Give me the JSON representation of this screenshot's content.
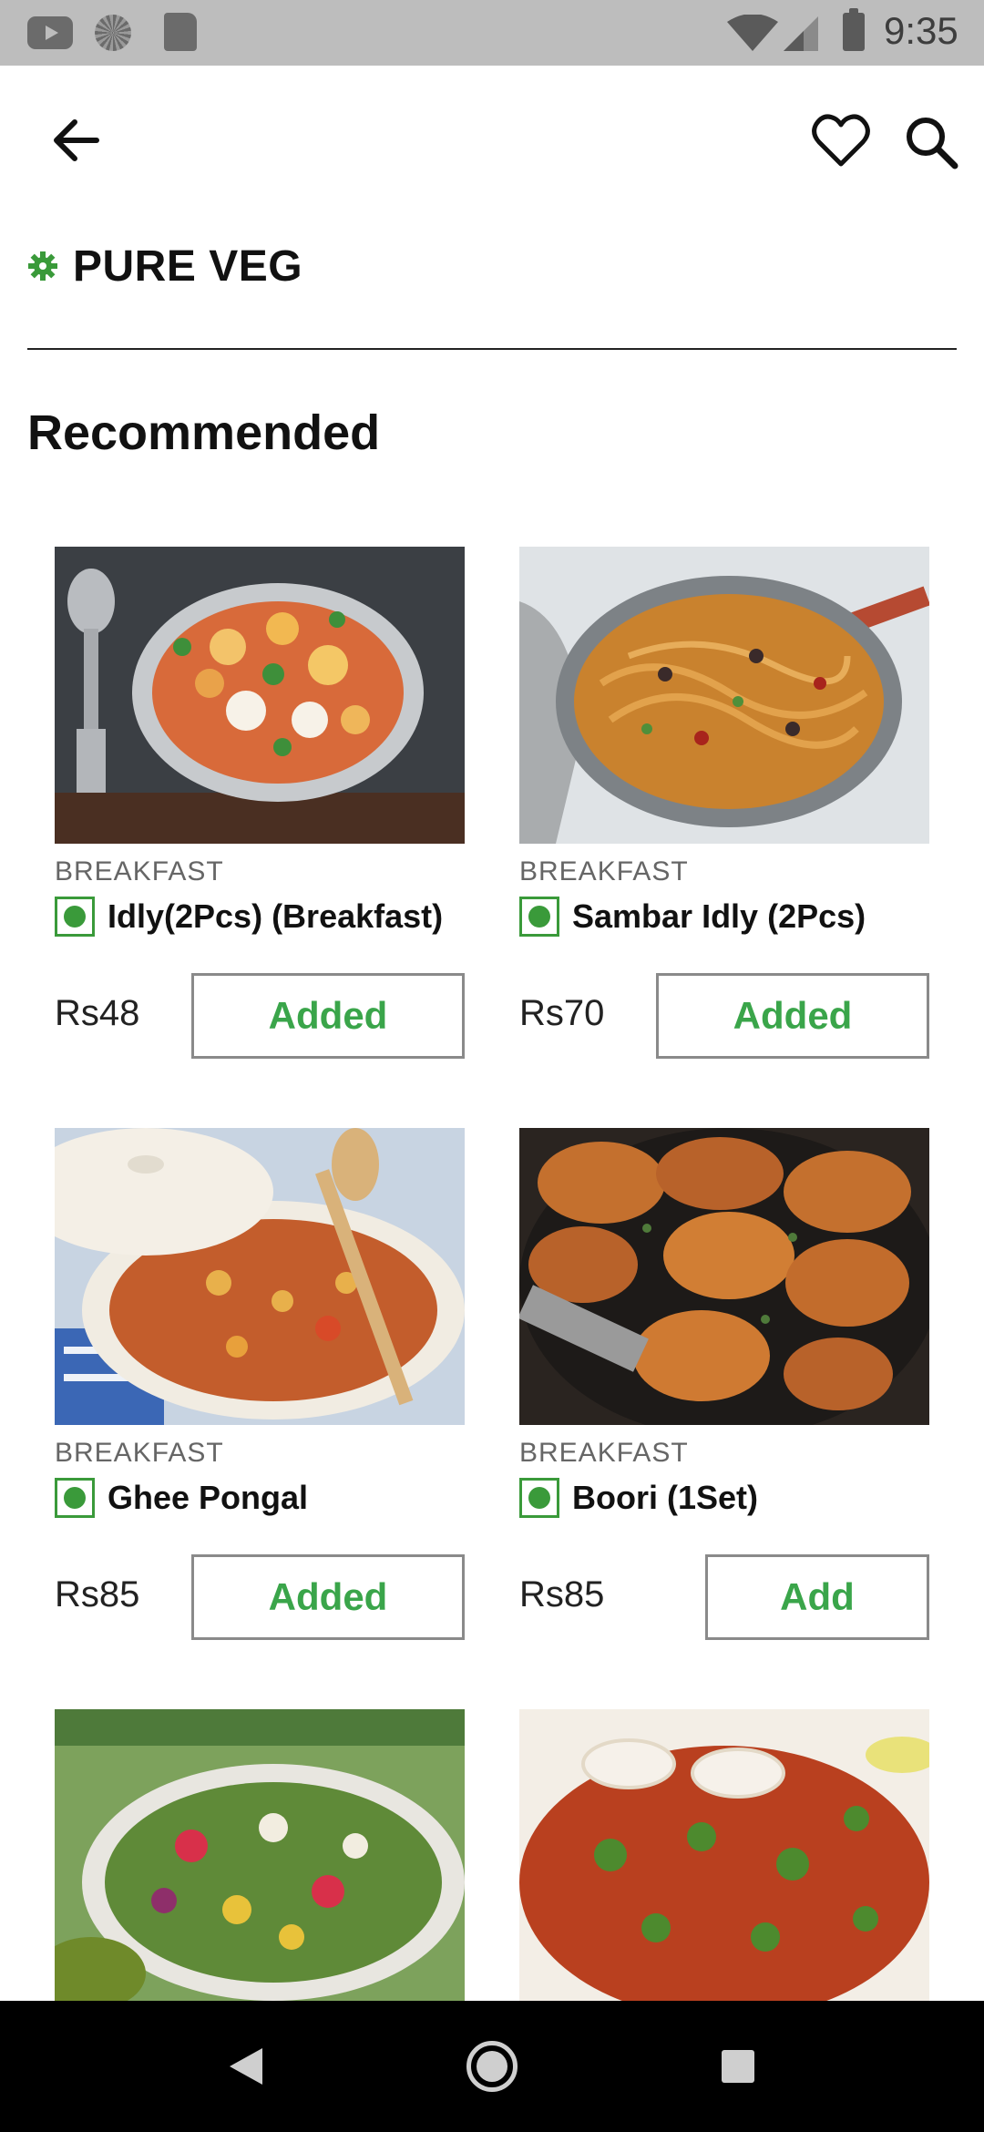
{
  "status_bar": {
    "time": "9:35",
    "icons": [
      "youtube-icon",
      "loading-icon",
      "sd-card-icon",
      "wifi-icon",
      "cell-signal-icon",
      "battery-icon"
    ]
  },
  "header": {
    "back_icon": "arrow-left-icon",
    "favorite_icon": "heart-outline-icon",
    "search_icon": "search-icon"
  },
  "filter": {
    "icon": "veg-gear-icon",
    "label": "PURE VEG",
    "accent_color": "#3a9a3a"
  },
  "section": {
    "title": "Recommended"
  },
  "items": [
    {
      "category": "BREAKFAST",
      "name": "Idly(2Pcs) (Breakfast)",
      "price": "Rs48",
      "button": "Added",
      "state": "added"
    },
    {
      "category": "BREAKFAST",
      "name": "Sambar Idly (2Pcs)",
      "price": "Rs70",
      "button": "Added",
      "state": "added"
    },
    {
      "category": "BREAKFAST",
      "name": "Ghee Pongal",
      "price": "Rs85",
      "button": "Added",
      "state": "added"
    },
    {
      "category": "BREAKFAST",
      "name": "Boori (1Set)",
      "price": "Rs85",
      "button": "Add",
      "state": "add"
    }
  ],
  "colors": {
    "button_text": "#3aa54a",
    "veg_mark": "#3a9a3a",
    "status_bar_bg": "#bdbdbd",
    "nav_bar_bg": "#000000"
  },
  "nav_bar": {
    "icons": [
      "nav-back-icon",
      "nav-home-icon",
      "nav-recents-icon"
    ]
  }
}
